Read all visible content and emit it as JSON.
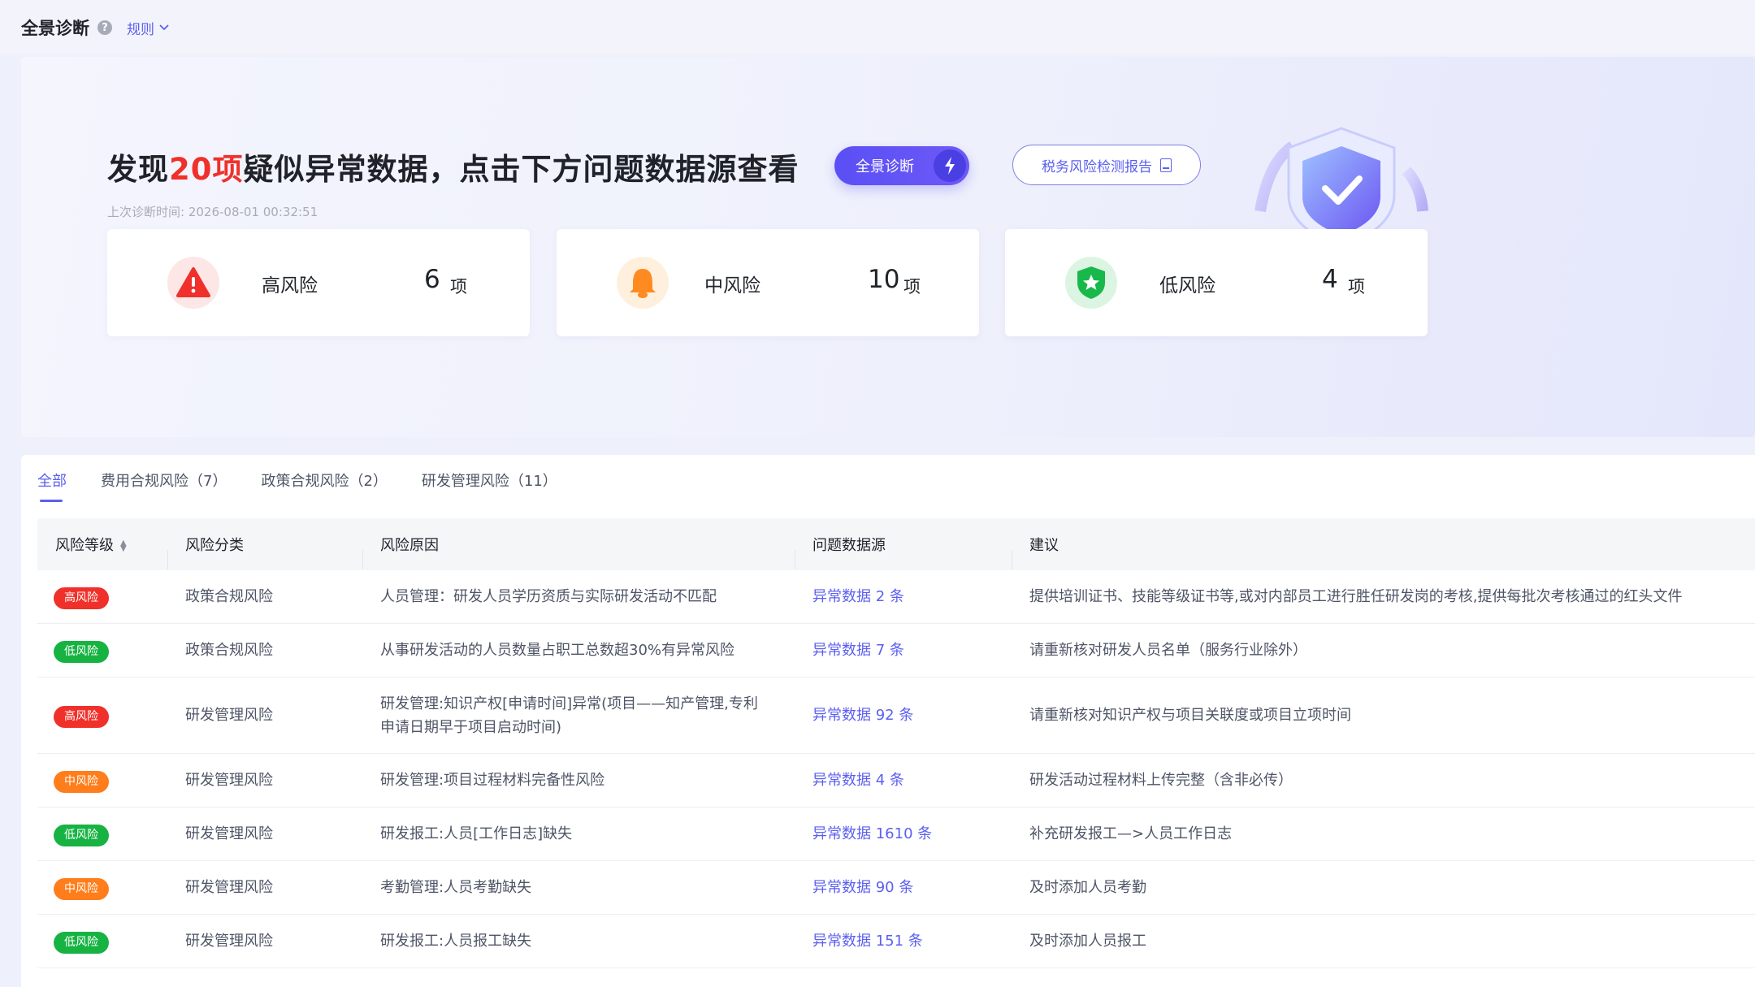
{
  "topbar": {
    "title": "全景诊断",
    "help_icon": "?",
    "rules_label": "规则"
  },
  "hero": {
    "headline_prefix": "发现",
    "headline_count": "20项",
    "headline_suffix": "疑似异常数据，点击下方问题数据源查看",
    "last_time": "上次诊断时间: 2026-08-01 00:32:51",
    "diagnose_button": "全景诊断",
    "report_button": "税务风险检测报告"
  },
  "cards": [
    {
      "label": "高风险",
      "count": "6",
      "unit": "项",
      "color": "#f0302a"
    },
    {
      "label": "中风险",
      "count": "10",
      "unit": "项",
      "color": "#ff8a1f"
    },
    {
      "label": "低风险",
      "count": "4",
      "unit": "项",
      "color": "#19b84a"
    }
  ],
  "tabs": [
    {
      "label": "全部",
      "active": true
    },
    {
      "label": "费用合规风险（7）"
    },
    {
      "label": "政策合规风险（2）"
    },
    {
      "label": "研发管理风险（11）"
    }
  ],
  "table": {
    "headers": {
      "level": "风险等级",
      "category": "风险分类",
      "reason": "风险原因",
      "source": "问题数据源",
      "advice": "建议"
    },
    "rows": [
      {
        "level": "高风险",
        "level_key": "high",
        "category": "政策合规风险",
        "reason": "人员管理：研发人员学历资质与实际研发活动不匹配",
        "source": "异常数据 2 条",
        "advice": "提供培训证书、技能等级证书等,或对内部员工进行胜任研发岗的考核,提供每批次考核通过的红头文件"
      },
      {
        "level": "低风险",
        "level_key": "low",
        "category": "政策合规风险",
        "reason": "从事研发活动的人员数量占职工总数超30%有异常风险",
        "source": "异常数据 7 条",
        "advice": "请重新核对研发人员名单（服务行业除外）"
      },
      {
        "level": "高风险",
        "level_key": "high",
        "category": "研发管理风险",
        "reason_line1": "研发管理:知识产权[申请时间]异常(项目——知产管理,专利",
        "reason_line2": "申请日期早于项目启动时间)",
        "source": "异常数据 92 条",
        "advice": "请重新核对知识产权与项目关联度或项目立项时间"
      },
      {
        "level": "中风险",
        "level_key": "mid",
        "category": "研发管理风险",
        "reason": "研发管理:项目过程材料完备性风险",
        "source": "异常数据 4 条",
        "advice": "研发活动过程材料上传完整（含非必传）"
      },
      {
        "level": "低风险",
        "level_key": "low",
        "category": "研发管理风险",
        "reason": "研发报工:人员[工作日志]缺失",
        "source": "异常数据 1610 条",
        "advice": "补充研发报工—>人员工作日志"
      },
      {
        "level": "中风险",
        "level_key": "mid",
        "category": "研发管理风险",
        "reason": "考勤管理:人员考勤缺失",
        "source": "异常数据 90 条",
        "advice": "及时添加人员考勤"
      },
      {
        "level": "低风险",
        "level_key": "low",
        "category": "研发管理风险",
        "reason": "研发报工:人员报工缺失",
        "source": "异常数据 151 条",
        "advice": "及时添加人员报工"
      }
    ]
  },
  "colors": {
    "accent": "#5b5ff0",
    "high": "#f0302a",
    "mid": "#ff7d1a",
    "low": "#16b342"
  }
}
